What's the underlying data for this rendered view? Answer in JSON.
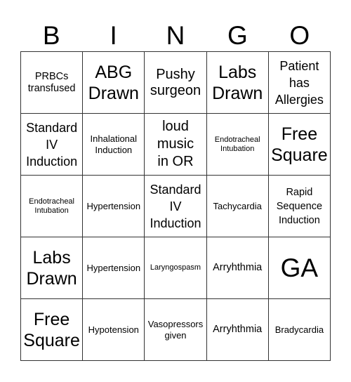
{
  "header": {
    "letters": [
      "B",
      "I",
      "N",
      "G",
      "O"
    ]
  },
  "grid": {
    "rows": [
      [
        {
          "text": "PRBCs\ntransfused",
          "size": "md"
        },
        {
          "text": "ABG\nDrawn",
          "size": "2xl"
        },
        {
          "text": "Pushy\nsurgeon",
          "size": "xl"
        },
        {
          "text": "Labs\nDrawn",
          "size": "2xl"
        },
        {
          "text": "Patient\nhas\nAllergies",
          "size": "lg-tight"
        }
      ],
      [
        {
          "text": "Standard\nIV\nInduction",
          "size": "lg-tight"
        },
        {
          "text": "Inhalational\nInduction",
          "size": "md"
        },
        {
          "text": "loud\nmusic\nin OR",
          "size": "xl-tight"
        },
        {
          "text": "Endotracheal\nIntubation",
          "size": "xs"
        },
        {
          "text": "Free\nSquare",
          "size": "2xl"
        }
      ],
      [
        {
          "text": "Endotracheal\nIntubation",
          "size": "xs"
        },
        {
          "text": "Hypertension",
          "size": "sm"
        },
        {
          "text": "Standard\nIV\nInduction",
          "size": "lg-tight"
        },
        {
          "text": "Tachycardia",
          "size": "sm"
        },
        {
          "text": "Rapid\nSequence\nInduction",
          "size": "md-tall"
        }
      ],
      [
        {
          "text": "Labs\nDrawn",
          "size": "2xl"
        },
        {
          "text": "Hypertension",
          "size": "sm"
        },
        {
          "text": "Laryngospasm",
          "size": "xs"
        },
        {
          "text": "Arryhthmia",
          "size": "md"
        },
        {
          "text": "GA",
          "size": "3xl"
        }
      ],
      [
        {
          "text": "Free\nSquare",
          "size": "2xl"
        },
        {
          "text": "Hypotension",
          "size": "sm"
        },
        {
          "text": "Vasopressors\ngiven",
          "size": "sm"
        },
        {
          "text": "Arryhthmia",
          "size": "md"
        },
        {
          "text": "Bradycardia",
          "size": "sm"
        }
      ]
    ]
  }
}
